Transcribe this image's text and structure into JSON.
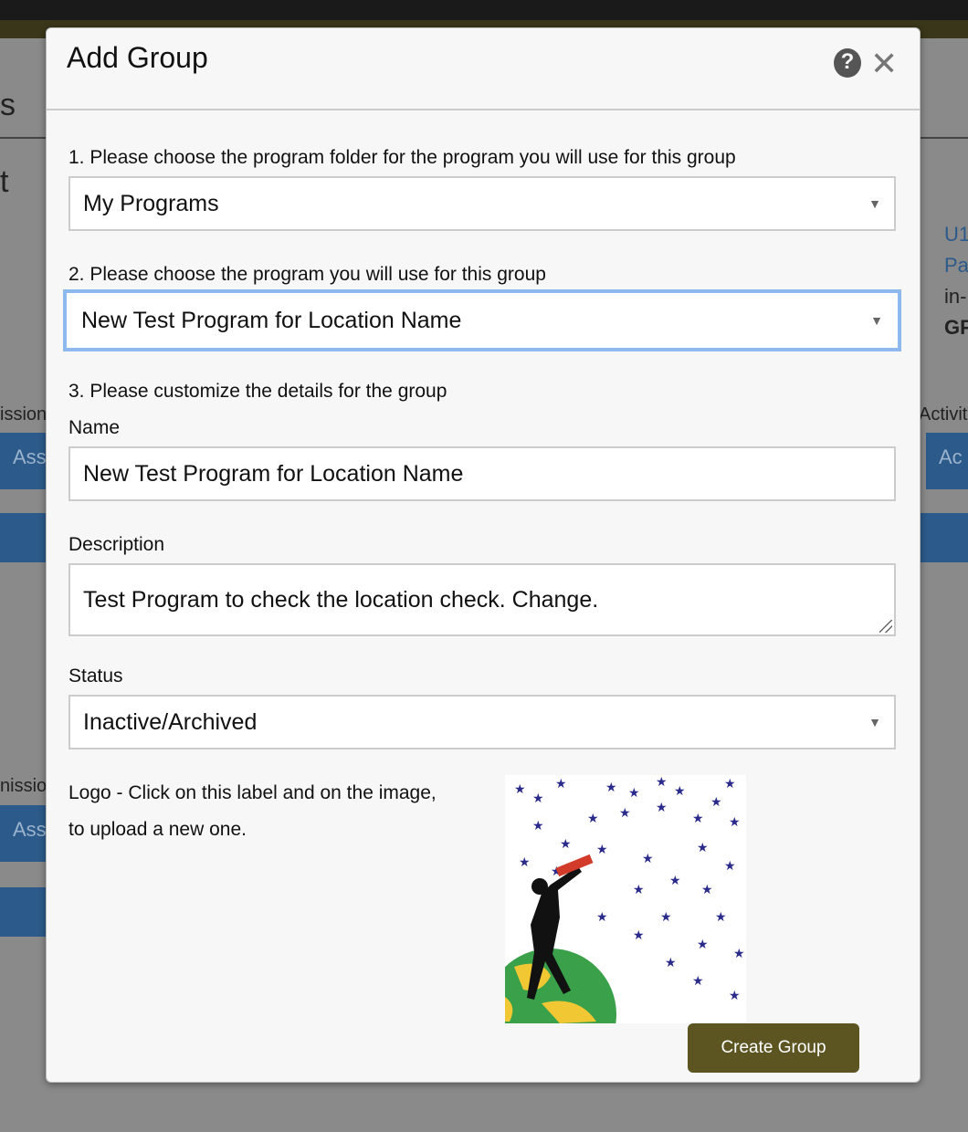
{
  "background": {
    "fragments": [
      "s",
      "t",
      "U1",
      "Pa",
      "in-",
      "GF",
      "issions",
      "Ass",
      "Activities",
      "Ac",
      "nissio",
      "Ass"
    ]
  },
  "modal": {
    "title": "Add Group",
    "help_icon": "question-circle-icon",
    "close_icon": "close-icon",
    "step1_label": "1. Please choose the program folder for the program you will use for this group",
    "folder_value": "My Programs",
    "step2_label": "2. Please choose the program you will use for this group",
    "program_value": "New Test Program for Location Name",
    "step3_label": "3. Please customize the details for the group",
    "name_label": "Name",
    "name_value": "New Test Program for Location Name",
    "description_label": "Description",
    "description_value": "Test Program to check the location check.  Change.",
    "status_label": "Status",
    "status_value": "Inactive/Archived",
    "logo_label_1": "Logo - Click on this label and on the image,",
    "logo_label_2": "to upload a new one.",
    "create_button": "Create Group",
    "accent_color": "#5c5521"
  }
}
